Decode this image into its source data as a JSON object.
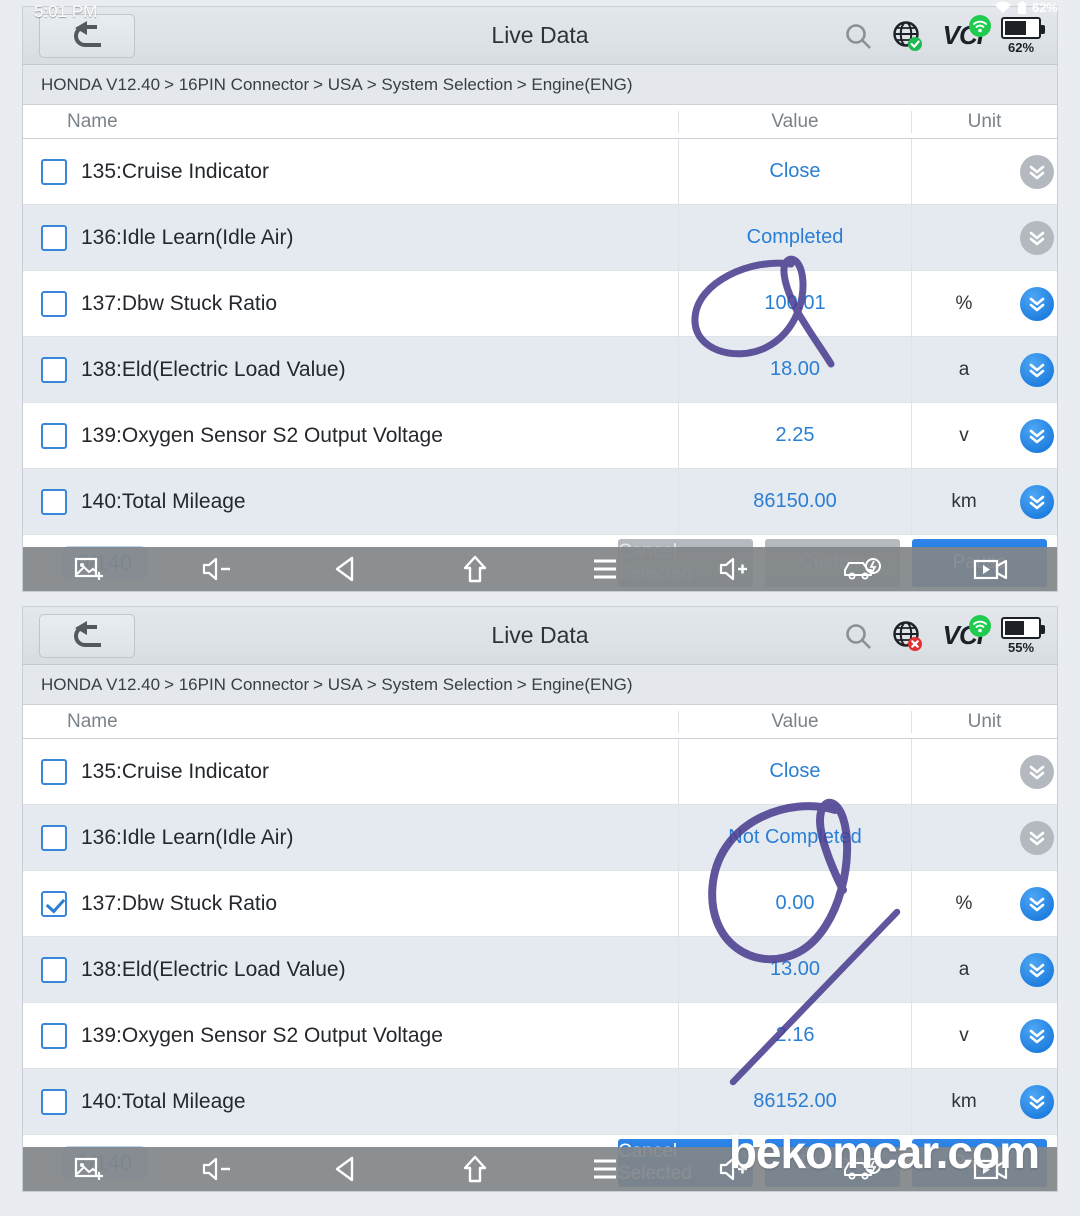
{
  "status_bar": {
    "time": "5:01 PM",
    "battery_percent": "62%",
    "wifi_icon": "wifi-icon",
    "battery_icon": "battery-icon"
  },
  "watermark": {
    "text": "bekomcar.com"
  },
  "panels": [
    {
      "id": "panel-top",
      "titlebar": {
        "title": "Live Data",
        "back_icon": "back-arrow-icon",
        "search_icon": "search-icon",
        "globe_icon": "globe-icon",
        "globe_status": "connected",
        "vci_label": "VCI",
        "vci_icon": "vci-wifi-icon",
        "battery_label": "62%",
        "battery_level": 62
      },
      "breadcrumb": [
        "HONDA V12.40",
        "> 16PIN Connector",
        "> USA",
        "> System Selection",
        "> Engine(ENG)"
      ],
      "columns": [
        "Name",
        "Value",
        "Unit"
      ],
      "rows": [
        {
          "name": "135:Cruise Indicator",
          "value": "Close",
          "unit": "",
          "checked": false,
          "chevron": "off",
          "stripe": "white"
        },
        {
          "name": "136:Idle Learn(Idle Air)",
          "value": "Completed",
          "unit": "",
          "checked": false,
          "chevron": "off",
          "stripe": "alt"
        },
        {
          "name": "137:Dbw Stuck Ratio",
          "value": "100.01",
          "unit": "%",
          "checked": false,
          "chevron": "on",
          "stripe": "white"
        },
        {
          "name": "138:Eld(Electric Load Value)",
          "value": "18.00",
          "unit": "a",
          "checked": false,
          "chevron": "on",
          "stripe": "alt"
        },
        {
          "name": "139:Oxygen Sensor S2 Output Voltage",
          "value": "2.25",
          "unit": "v",
          "checked": false,
          "chevron": "on",
          "stripe": "white"
        },
        {
          "name": "140:Total Mileage",
          "value": "86150.00",
          "unit": "km",
          "checked": false,
          "chevron": "on",
          "stripe": "alt"
        }
      ],
      "bottombar": {
        "counter": "0/140",
        "screenshot_icon": "screenshot-icon",
        "buttons": [
          {
            "label": "Cancel Selected",
            "state": "disabled",
            "icon": "cancel-icon"
          },
          {
            "label": "Custom",
            "state": "disabled",
            "icon": "car-custom-icon"
          },
          {
            "label": "Pause",
            "state": "primary",
            "icon": "record-video-icon"
          }
        ]
      },
      "navbar": {
        "items": [
          "volume-down-icon",
          "back-triangle-icon",
          "home-icon",
          "menu-icon"
        ]
      },
      "annotation": "circled-value-100.01"
    },
    {
      "id": "panel-bottom",
      "titlebar": {
        "title": "Live Data",
        "back_icon": "back-arrow-icon",
        "search_icon": "search-icon",
        "globe_icon": "globe-icon",
        "globe_status": "disconnected",
        "vci_label": "VCI",
        "vci_icon": "vci-wifi-icon",
        "battery_label": "55%",
        "battery_level": 55
      },
      "breadcrumb": [
        "HONDA V12.40",
        "> 16PIN Connector",
        "> USA",
        "> System Selection",
        "> Engine(ENG)"
      ],
      "columns": [
        "Name",
        "Value",
        "Unit"
      ],
      "rows": [
        {
          "name": "135:Cruise Indicator",
          "value": "Close",
          "unit": "",
          "checked": false,
          "chevron": "off",
          "stripe": "white"
        },
        {
          "name": "136:Idle Learn(Idle Air)",
          "value": "Not Completed",
          "unit": "",
          "checked": false,
          "chevron": "off",
          "stripe": "alt"
        },
        {
          "name": "137:Dbw Stuck Ratio",
          "value": "0.00",
          "unit": "%",
          "checked": true,
          "chevron": "on",
          "stripe": "white"
        },
        {
          "name": "138:Eld(Electric Load Value)",
          "value": "13.00",
          "unit": "a",
          "checked": false,
          "chevron": "on",
          "stripe": "alt"
        },
        {
          "name": "139:Oxygen Sensor S2 Output Voltage",
          "value": "2.16",
          "unit": "v",
          "checked": false,
          "chevron": "on",
          "stripe": "white"
        },
        {
          "name": "140:Total Mileage",
          "value": "86152.00",
          "unit": "km",
          "checked": false,
          "chevron": "on",
          "stripe": "alt"
        }
      ],
      "bottombar": {
        "counter": "1/140",
        "screenshot_icon": "screenshot-icon",
        "buttons": [
          {
            "label": "Cancel Selected",
            "state": "primary",
            "icon": "cancel-icon"
          },
          {
            "label": "Custom",
            "state": "primary",
            "icon": "car-custom-icon"
          },
          {
            "label": "Pause",
            "state": "primary",
            "icon": "record-video-icon"
          }
        ]
      },
      "navbar": {
        "items": [
          "volume-down-icon",
          "back-triangle-icon",
          "home-icon",
          "menu-icon"
        ]
      },
      "annotation": "circled-value-0.00"
    }
  ],
  "colors": {
    "value_blue": "#2a7fd4",
    "accent_blue": "#1565c8",
    "ink_purple": "#4b3f8f",
    "row_alt": "#e5eaf1",
    "chrome": "#dde2e7"
  }
}
